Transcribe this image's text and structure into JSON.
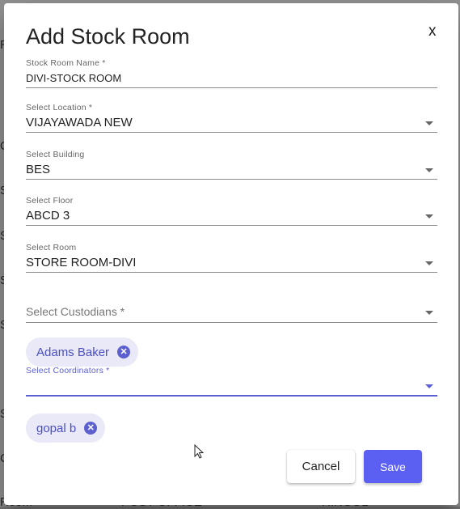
{
  "background": {
    "fragments": [
      "R",
      "C",
      "S",
      "S",
      "S",
      "S",
      "S",
      "C",
      "Room",
      "POST OFFICE",
      "HINGOL"
    ]
  },
  "dialog": {
    "title": "Add Stock Room",
    "close_label": "x",
    "fields": {
      "stock_room_name": {
        "label": "Stock Room Name *",
        "value": "DIVI-STOCK ROOM"
      },
      "location": {
        "label": "Select Location *",
        "value": "VIJAYAWADA NEW"
      },
      "building": {
        "label": "Select Building",
        "value": "BES"
      },
      "floor": {
        "label": "Select Floor",
        "value": "ABCD 3"
      },
      "room": {
        "label": "Select Room",
        "value": "STORE ROOM-DIVI"
      },
      "custodians": {
        "placeholder": "Select Custodians *"
      },
      "coordinators": {
        "label": "Select Coordinators *",
        "value": ""
      }
    },
    "custodian_chips": [
      "Adams Baker"
    ],
    "coordinator_chips": [
      "gopal b"
    ],
    "chip_remove_glyph": "✕",
    "buttons": {
      "cancel": "Cancel",
      "save": "Save"
    }
  },
  "colors": {
    "accent": "#5c60f2",
    "chip_bg": "#e9e9f8",
    "chip_text": "#4b4fc4"
  }
}
